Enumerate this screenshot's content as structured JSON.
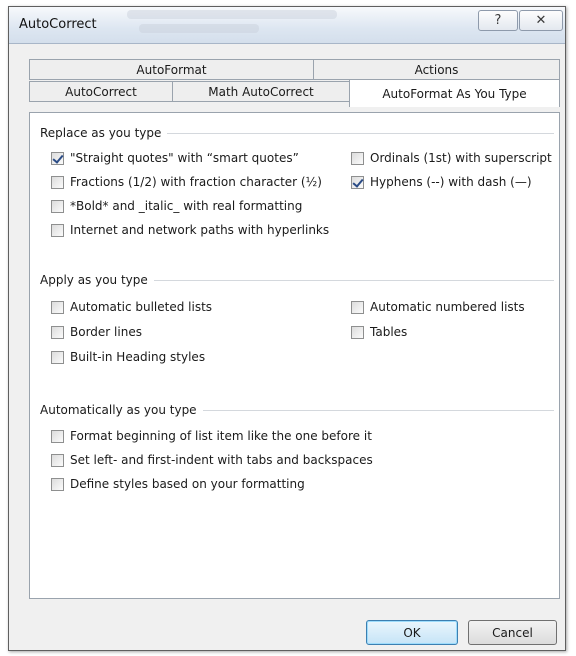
{
  "window": {
    "title": "AutoCorrect"
  },
  "titlebar": {
    "help_glyph": "?",
    "close_glyph": "✕"
  },
  "tabs": {
    "back_row": [
      "AutoFormat",
      "Actions"
    ],
    "front_row": [
      "AutoCorrect",
      "Math AutoCorrect",
      "AutoFormat As You Type"
    ],
    "active": "AutoFormat As You Type"
  },
  "sections": {
    "replace": {
      "header": "Replace as you type",
      "items": [
        {
          "label": "\"Straight quotes\" with “smart quotes”",
          "checked": true
        },
        {
          "label": "Fractions (1/2) with fraction character (½)",
          "checked": false
        },
        {
          "label": "*Bold* and _italic_ with real formatting",
          "checked": false
        },
        {
          "label": "Internet and network paths with hyperlinks",
          "checked": false
        },
        {
          "label": "Ordinals (1st) with superscript",
          "checked": false
        },
        {
          "label": "Hyphens (--) with dash (—)",
          "checked": true
        }
      ]
    },
    "apply": {
      "header": "Apply as you type",
      "items": [
        {
          "label": "Automatic bulleted lists",
          "checked": false
        },
        {
          "label": "Border lines",
          "checked": false
        },
        {
          "label": "Built-in Heading styles",
          "checked": false
        },
        {
          "label": "Automatic numbered lists",
          "checked": false
        },
        {
          "label": "Tables",
          "checked": false
        }
      ]
    },
    "auto": {
      "header": "Automatically as you type",
      "items": [
        {
          "label": "Format beginning of list item like the one before it",
          "checked": false
        },
        {
          "label": "Set left- and first-indent with tabs and backspaces",
          "checked": false
        },
        {
          "label": "Define styles based on your formatting",
          "checked": false
        }
      ]
    }
  },
  "buttons": {
    "ok": "OK",
    "cancel": "Cancel"
  }
}
